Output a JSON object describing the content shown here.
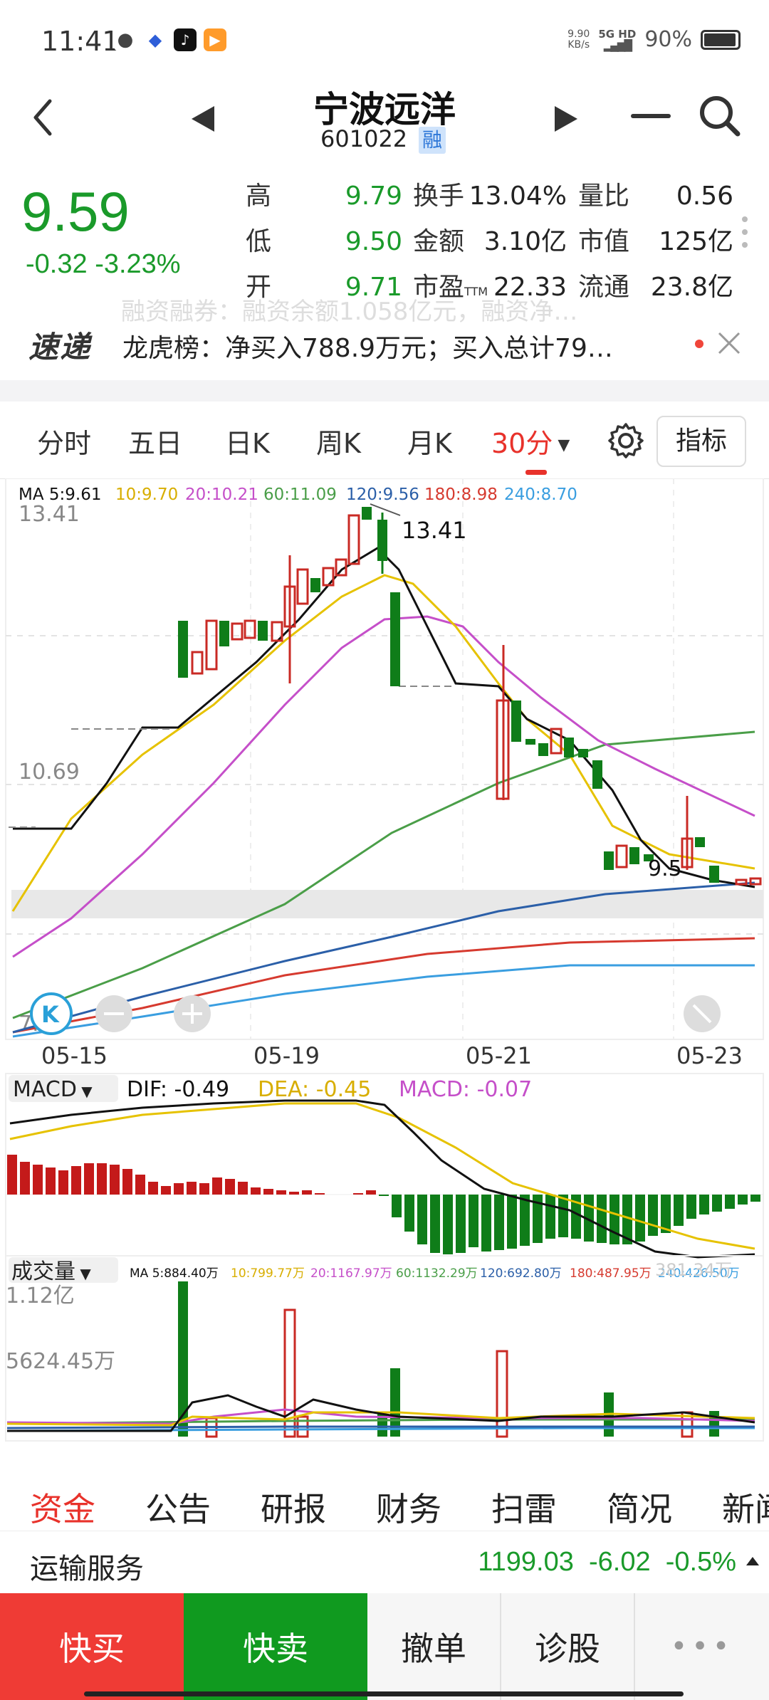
{
  "status": {
    "time": "11:41",
    "net_speed_value": "9.90",
    "net_speed_unit": "KB/s",
    "network": "5G HD",
    "battery": "90%",
    "apps": [
      "wechat-icon",
      "baidu-icon",
      "tiktok-icon",
      "video-app-icon"
    ]
  },
  "header": {
    "stock_name": "宁波远洋",
    "stock_code": "601022",
    "margin_badge": "融"
  },
  "quote": {
    "price": "9.59",
    "change": "-0.32",
    "change_pct": "-3.23%",
    "col1": [
      {
        "label": "高",
        "value": "9.79"
      },
      {
        "label": "低",
        "value": "9.50"
      },
      {
        "label": "开",
        "value": "9.71"
      }
    ],
    "col2": [
      {
        "label": "换手",
        "value": "13.04%"
      },
      {
        "label": "金额",
        "value": "3.10亿"
      },
      {
        "label": "市盈",
        "sub": "TTM",
        "value": "22.33"
      }
    ],
    "col3": [
      {
        "label": "量比",
        "value": "0.56"
      },
      {
        "label": "市值",
        "value": "125亿"
      },
      {
        "label": "流通",
        "value": "23.8亿"
      }
    ]
  },
  "news": {
    "ghost": "融资融券：融资余额1.058亿元，融资净…",
    "logo": "速递",
    "text": "龙虎榜：净买入788.9万元；买入总计79…"
  },
  "period_tabs": {
    "items": [
      "分时",
      "五日",
      "日K",
      "周K",
      "月K",
      "30分"
    ],
    "active": "30分",
    "indicator": "指标"
  },
  "ma_legend": [
    {
      "label": "MA 5:9.61",
      "color": "#111111"
    },
    {
      "label": "10:9.70",
      "color": "#e6b800"
    },
    {
      "label": "20:10.21",
      "color": "#c54fc9"
    },
    {
      "label": "60:11.09",
      "color": "#4a9e48"
    },
    {
      "label": "120:9.56",
      "color": "#2b5fa8"
    },
    {
      "label": "180:8.98",
      "color": "#d63a2f"
    },
    {
      "label": "240:8.70",
      "color": "#3a9ee0"
    }
  ],
  "price_chart": {
    "y_labels": [
      "13.41",
      "10.69",
      "7.96"
    ],
    "high_marker": "13.41",
    "low_marker": "9.5",
    "dates": [
      "05-15",
      "05-19",
      "05-21",
      "05-23"
    ]
  },
  "macd": {
    "selector": "MACD",
    "dif": "DIF: -0.49",
    "dea": "DEA: -0.45",
    "macd": "MACD: -0.07"
  },
  "volume": {
    "selector": "成交量",
    "ma_legend": [
      {
        "label": "MA  5:884.40万",
        "color": "#111111"
      },
      {
        "label": "10:799.77万",
        "color": "#e6b800"
      },
      {
        "label": "20:1167.97万",
        "color": "#c54fc9"
      },
      {
        "label": "60:1132.29万",
        "color": "#4a9e48"
      },
      {
        "label": "120:692.80万",
        "color": "#2b5fa8"
      },
      {
        "label": "180:487.95万",
        "color": "#d63a2f"
      },
      {
        "label": "240:426.50万",
        "color": "#3a9ee0"
      }
    ],
    "y_labels": [
      "1.12亿",
      "5624.45万"
    ],
    "right_ghost": "381.34万"
  },
  "info_tabs": {
    "items": [
      "资金",
      "公告",
      "研报",
      "财务",
      "扫雷",
      "简况",
      "新闻"
    ],
    "active": "资金"
  },
  "industry": {
    "name": "运输服务",
    "value": "1199.03",
    "change": "-6.02",
    "pct": "-0.5%"
  },
  "actions": {
    "buy": "快买",
    "sell": "快卖",
    "cancel": "撤单",
    "diagnose": "诊股",
    "more": "•••"
  },
  "colors": {
    "up": "#d0312d",
    "down": "#0f7d19",
    "active": "#e8322b"
  }
}
